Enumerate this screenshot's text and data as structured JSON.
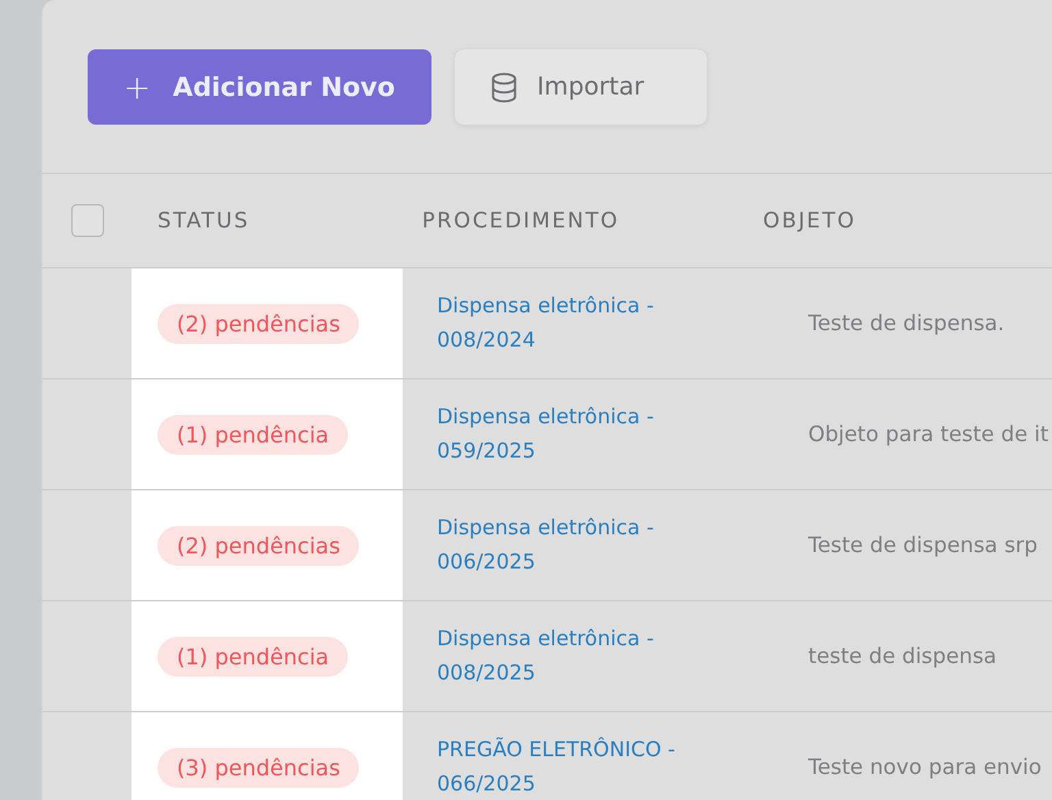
{
  "toolbar": {
    "add_button": {
      "icon": "+",
      "label": "Adicionar Novo"
    },
    "import_button": {
      "label": "Importar"
    }
  },
  "table": {
    "select_all": {
      "checked": false
    },
    "columns": [
      "STATUS",
      "PROCEDIMENTO",
      "OBJETO"
    ],
    "rows": [
      {
        "status": "(2) pendências",
        "procedimento": [
          "Dispensa eletrônica -",
          "008/2024"
        ],
        "objeto": "Teste de dispensa."
      },
      {
        "status": "(1) pendência",
        "procedimento": [
          "Dispensa eletrônica -",
          "059/2025"
        ],
        "objeto": "Objeto para teste de it"
      },
      {
        "status": "(2) pendências",
        "procedimento": [
          "Dispensa eletrônica -",
          "006/2025"
        ],
        "objeto": "Teste de dispensa srp"
      },
      {
        "status": "(1) pendência",
        "procedimento": [
          "Dispensa eletrônica -",
          "008/2025"
        ],
        "objeto": "teste de dispensa"
      },
      {
        "status": "(3) pendências",
        "procedimento": [
          "PREGÃO ELETRÔNICO -",
          "066/2025"
        ],
        "objeto": "Teste novo para envio"
      }
    ]
  }
}
